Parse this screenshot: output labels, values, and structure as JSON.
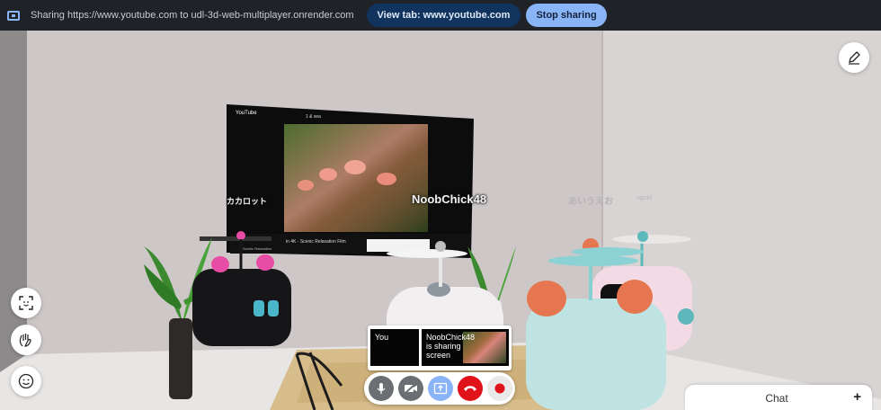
{
  "share_bar": {
    "message": "Sharing https://www.youtube.com to udl-3d-web-multiplayer.onrender.com",
    "view_tab_label": "View tab: www.youtube.com",
    "stop_label": "Stop sharing"
  },
  "screen": {
    "logo": "YouTube",
    "search_text": "1 & sea",
    "video_title": "in 4K - Scenic Relaxation Film",
    "channel_text": "Scenic Relaxation"
  },
  "name_tags": {
    "left": "カカロット",
    "center": "NoobChick48",
    "right": "あいうえお",
    "faint": "ngoid"
  },
  "tiles": {
    "you_label": "You",
    "share_label": "NoobChick48 is sharing screen"
  },
  "call_controls": [
    "mic-icon",
    "camera-off-icon",
    "share-screen-icon",
    "hangup-icon",
    "record-icon"
  ],
  "side_buttons": [
    "face-tracking-icon",
    "wave-hand-icon",
    "emoji-icon"
  ],
  "chat": {
    "label": "Chat",
    "add": "+"
  }
}
